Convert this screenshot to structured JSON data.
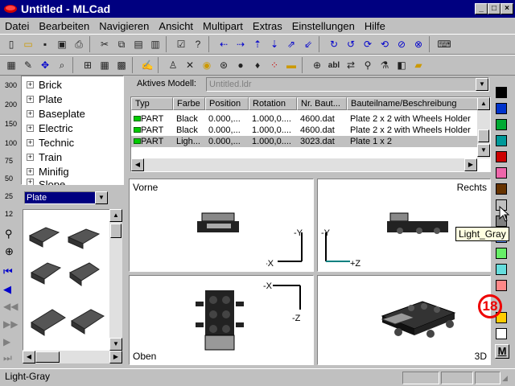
{
  "window": {
    "title": "Untitled - MLCad",
    "min": "_",
    "max": "□",
    "close": "×"
  },
  "menu": [
    "Datei",
    "Bearbeiten",
    "Navigieren",
    "Ansicht",
    "Multipart",
    "Extras",
    "Einstellungen",
    "Hilfe"
  ],
  "toolbar1": [
    "new-icon",
    "open-icon",
    "save-icon",
    "save-all-icon",
    "print-icon",
    "cut-icon",
    "copy-icon",
    "paste-icon",
    "paste-special-icon",
    "properties-icon",
    "whatsthis-icon",
    "move-left-icon",
    "move-right-icon",
    "move-up-icon",
    "move-down-icon",
    "move-plus-icon",
    "move-minus-icon",
    "rotate-x-icon",
    "rotate-x2-icon",
    "rotate-y-icon",
    "rotate-y2-icon",
    "rotate-z-icon",
    "rotate-z2-icon",
    "keyboard-icon"
  ],
  "toolbar2": [
    "select-icon",
    "edit-icon",
    "move-icon",
    "zoom-icon",
    "grid-coarse-icon",
    "grid-medium-icon",
    "grid-fine-icon",
    "draw-icon",
    "person-icon",
    "tools-icon",
    "color-icon",
    "rotation-icon",
    "lamp-icon",
    "lamp-off-icon",
    "grid-dots-icon",
    "folder-icon",
    "add-part-icon",
    "text-icon",
    "replace-icon",
    "search-icon",
    "filter-icon",
    "model-icon",
    "folder-open-icon"
  ],
  "zoom_labels": [
    "300",
    "200",
    "150",
    "100",
    "75",
    "50",
    "25",
    "12"
  ],
  "tree": [
    "Brick",
    "Plate",
    "Baseplate",
    "Electric",
    "Technic",
    "Train",
    "Minifig",
    "Slope"
  ],
  "category_select": "Plate",
  "model": {
    "label": "Aktives Modell:",
    "value": "Untitled.ldr"
  },
  "table": {
    "headers": [
      "Typ",
      "Farbe",
      "Position",
      "Rotation",
      "Nr. Baut...",
      "Bauteilname/Beschreibung"
    ],
    "rows": [
      [
        "PART",
        "Black",
        "0.000,...",
        "1.000,0....",
        "4600.dat",
        "Plate  2 x  2 with Wheels Holder"
      ],
      [
        "PART",
        "Black",
        "0.000,...",
        "1.000,0....",
        "4600.dat",
        "Plate  2 x  2 with Wheels Holder"
      ],
      [
        "PART",
        "Ligh...",
        "0.000,...",
        "1.000,0....",
        "3023.dat",
        "Plate  1 x  2"
      ]
    ]
  },
  "viewports": {
    "front": "Vorne",
    "right": "Rechts",
    "top": "Oben",
    "threed": "3D"
  },
  "axes": {
    "y": "-Y",
    "x": "-X",
    "z": "+Z",
    "x2": "-X",
    "z2": "-Z"
  },
  "tooltip": "Light_Gray",
  "badge": "18",
  "palette_letter": "M",
  "palette": [
    "#000000",
    "#0033cc",
    "#00aa33",
    "#009999",
    "#cc0000",
    "#ee66aa",
    "#663300",
    "#c0c0c0",
    "#808080",
    "#6699ff",
    "#66ee66",
    "#66dddd",
    "#ff8888",
    "#ffcc00",
    "#ffffff"
  ],
  "status": "Light-Gray"
}
